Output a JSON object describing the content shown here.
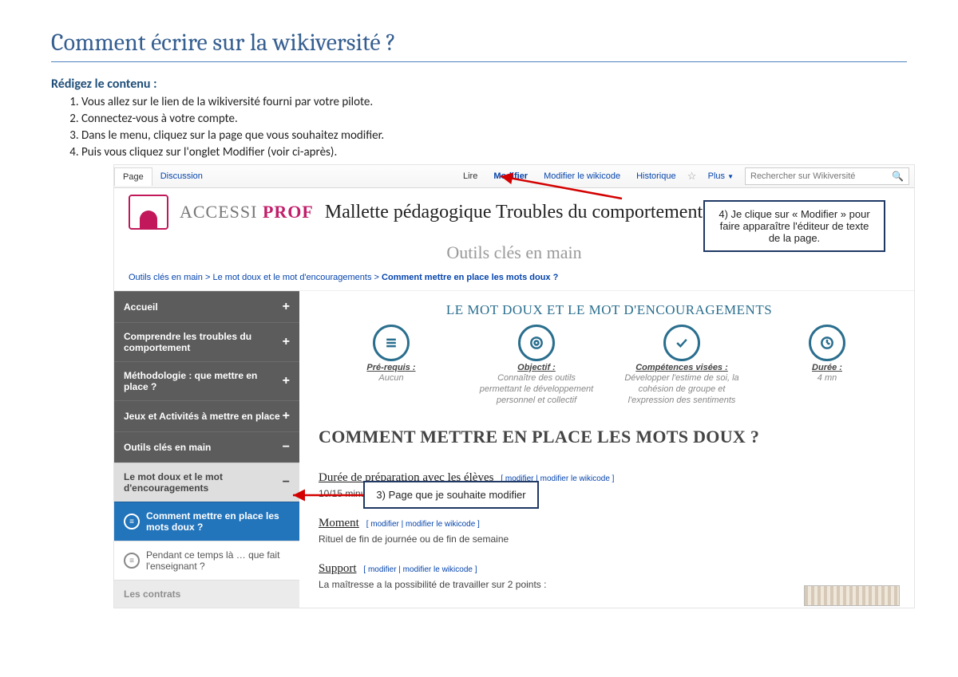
{
  "doc": {
    "title": "Comment écrire sur la wikiversité   ?",
    "sub_head": "Rédigez le contenu :",
    "steps": [
      "Vous allez sur le lien de la wikiversité fourni par votre pilote.",
      "Connectez-vous à votre compte.",
      "Dans le menu, cliquez sur la page que vous souhaitez modifier.",
      "Puis vous cliquez sur l'onglet Modifier (voir ci-après)."
    ]
  },
  "tabs": {
    "page": "Page",
    "discussion": "Discussion",
    "lire": "Lire",
    "modifier": "Modifier",
    "modwiki": "Modifier le wikicode",
    "hist": "Historique",
    "plus": "Plus"
  },
  "search": {
    "placeholder": "Rechercher sur Wikiversité"
  },
  "brand": {
    "a": "ACCESSI ",
    "b": "PROF"
  },
  "header": {
    "title": "Mallette pédagogique Troubles du comportement",
    "subtitle": "Outils clés en main"
  },
  "crumbs": {
    "a": "Outils clés en main",
    "b": "Le mot doux et le mot d'encouragements",
    "c": "Comment mettre en place les mots doux ?"
  },
  "sidebar": {
    "accueil": "Accueil",
    "comp": "Comprendre les troubles du comportement",
    "meth": "Méthodologie : que mettre en place ?",
    "jeux": "Jeux et Activités à mettre en place",
    "outils": "Outils clés en main",
    "motdoux": "Le mot doux et le mot d'encouragements",
    "comment": "Comment mettre en place les mots doux ?",
    "pendant": "Pendant ce temps là … que fait l'enseignant ?",
    "contrats": "Les contrats"
  },
  "content": {
    "section_title": "LE MOT DOUX ET LE MOT D'ENCOURAGEMENTS",
    "cols": {
      "prereq": {
        "label": "Pré-requis :",
        "val": "Aucun"
      },
      "obj": {
        "label": "Objectif :",
        "val": "Connaître des outils permettant le développement personnel et collectif"
      },
      "comp": {
        "label": "Compétences visées :",
        "val": "Développer l'estime de soi, la cohésion de groupe et l'expression des sentiments"
      },
      "duree": {
        "label": "Durée :",
        "val": "4 mn"
      }
    },
    "big_h": "COMMENT METTRE EN PLACE LES MOTS DOUX ?",
    "s1": {
      "h": "Durée de préparation avec les élèves",
      "edit": "[ modifier | modifier le wikicode ]",
      "txt": "10/15 minutes"
    },
    "s2": {
      "h": "Moment",
      "edit": "[ modifier | modifier le wikicode ]",
      "txt": "Rituel de fin de journée ou de fin de semaine"
    },
    "s3": {
      "h": "Support",
      "edit": "[ modifier | modifier le wikicode ]",
      "txt": "La maîtresse a la possibilité de travailler sur 2 points :"
    }
  },
  "ann": {
    "top": "4) Je clique sur « Modifier » pour faire apparaître l'éditeur de texte de la page.",
    "mid": "3) Page que je souhaite modifier"
  }
}
